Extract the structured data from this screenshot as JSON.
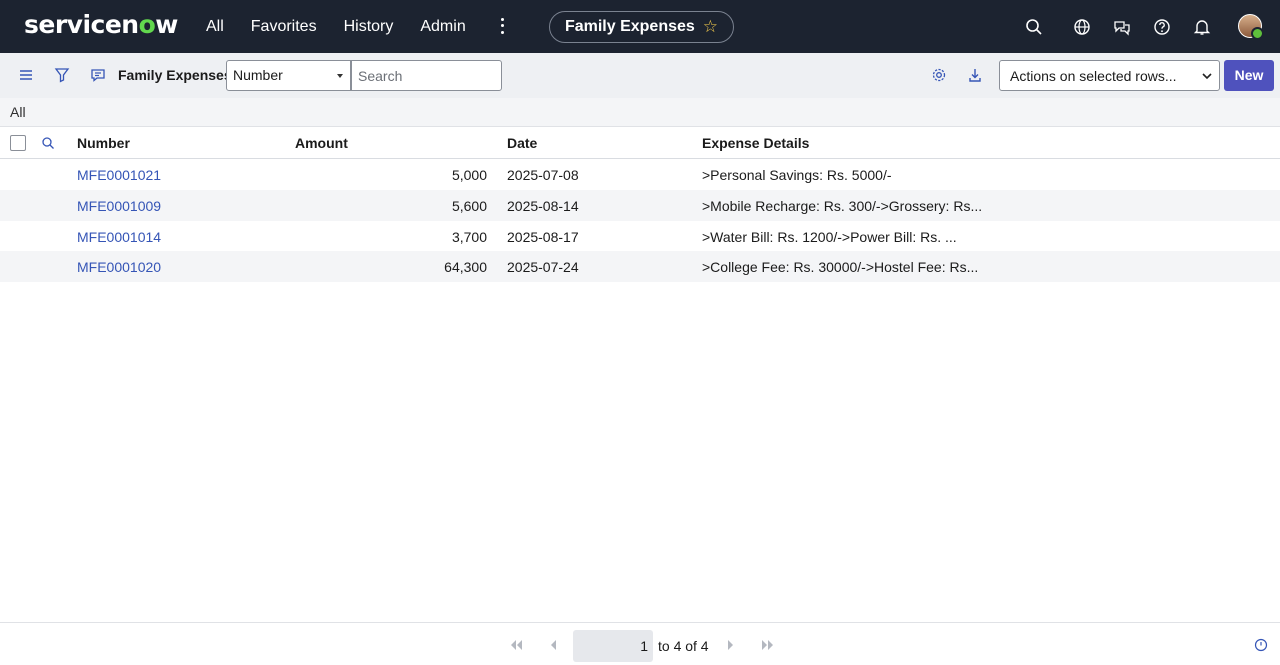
{
  "nav": {
    "logo": "servicenow",
    "links": [
      "All",
      "Favorites",
      "History",
      "Admin"
    ],
    "title": "Family Expenses"
  },
  "toolbar": {
    "list_title": "Family Expenses",
    "field_select": "Number",
    "search_placeholder": "Search",
    "actions_select": "Actions on selected rows...",
    "new_label": "New"
  },
  "breadcrumb": "All",
  "table": {
    "headers": [
      "Number",
      "Amount",
      "Date",
      "Expense Details"
    ],
    "rows": [
      {
        "number": "MFE0001021",
        "amount": "5,000",
        "date": "2025-07-08",
        "details": ">Personal Savings: Rs. 5000/-"
      },
      {
        "number": "MFE0001009",
        "amount": "5,600",
        "date": "2025-08-14",
        "details": ">Mobile Recharge: Rs. 300/->Grossery: Rs..."
      },
      {
        "number": "MFE0001014",
        "amount": "3,700",
        "date": "2025-08-17",
        "details": ">Water Bill: Rs. 1200/->Power Bill: Rs. ..."
      },
      {
        "number": "MFE0001020",
        "amount": "64,300",
        "date": "2025-07-24",
        "details": ">College Fee: Rs. 30000/->Hostel Fee: Rs..."
      }
    ]
  },
  "pagination": {
    "page_input": "1",
    "range_text": "to 4 of 4"
  },
  "colors": {
    "nav_bg": "#1c2330",
    "accent": "#4f52bd",
    "link": "#3555b6"
  }
}
